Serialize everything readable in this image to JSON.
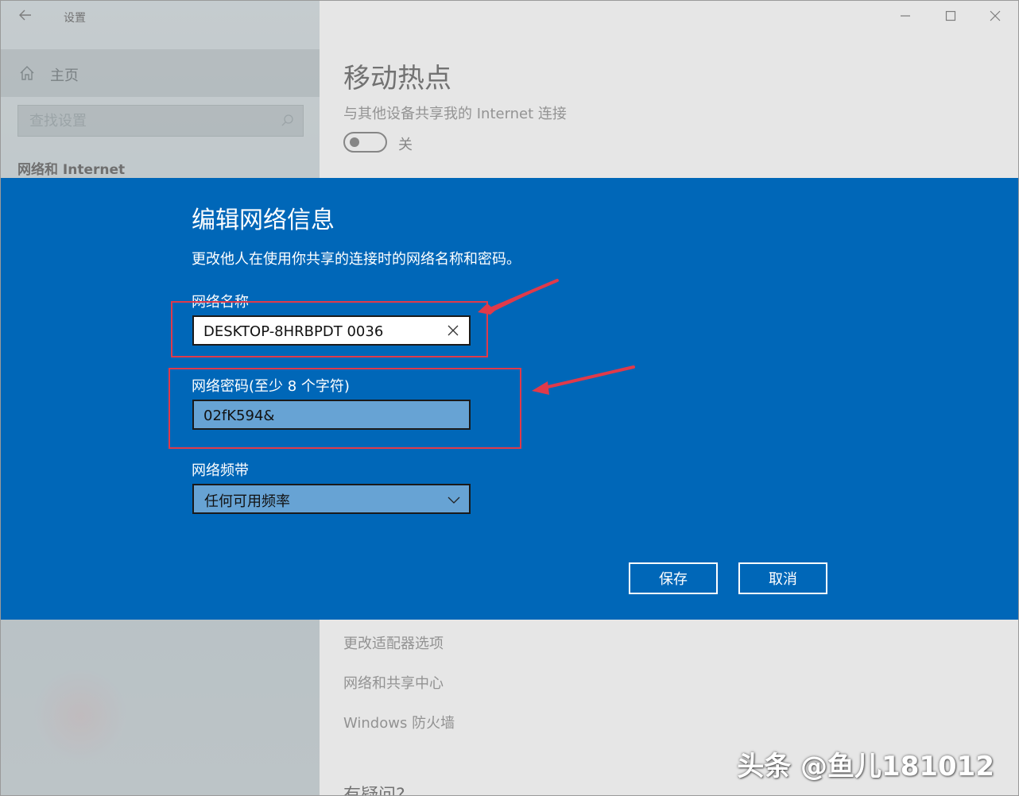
{
  "app": {
    "title": "设置"
  },
  "sidebar": {
    "home_label": "主页",
    "search_placeholder": "查找设置",
    "section_label": "网络和 Internet"
  },
  "main": {
    "page_title": "移动热点",
    "share_label": "与其他设备共享我的 Internet 连接",
    "toggle_state": "关",
    "related_links": [
      "更改适配器选项",
      "网络和共享中心",
      "Windows 防火墙"
    ],
    "help_heading": "有疑问?"
  },
  "dialog": {
    "title": "编辑网络信息",
    "description": "更改他人在使用你共享的连接时的网络名称和密码。",
    "name_label": "网络名称",
    "name_value": "DESKTOP-8HRBPDT 0036",
    "password_label": "网络密码(至少 8 个字符)",
    "password_value": "02fK594&",
    "band_label": "网络频带",
    "band_value": "任何可用频率",
    "save_label": "保存",
    "cancel_label": "取消"
  },
  "colors": {
    "dialog_bg": "#0067b8",
    "annotation": "#e03a4a"
  },
  "watermark": "头条 @鱼儿181012"
}
